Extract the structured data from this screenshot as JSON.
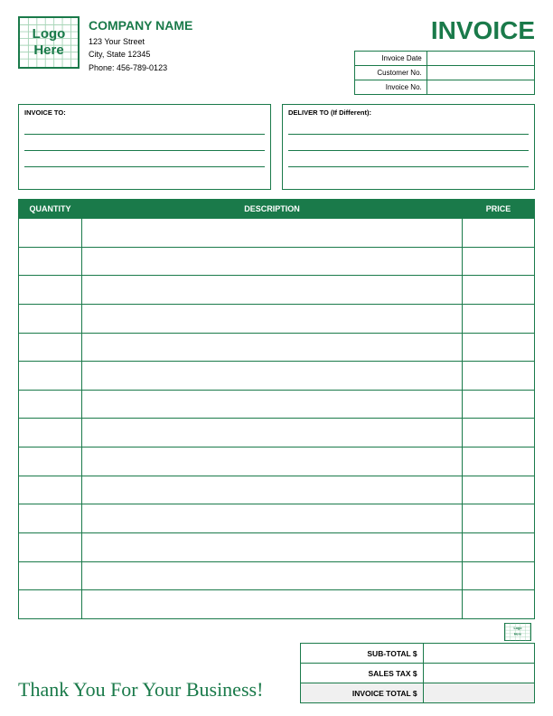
{
  "header": {
    "logo_line1": "Logo",
    "logo_line2": "Here",
    "company_name": "COMPANY NAME",
    "address_line1": "123 Your Street",
    "address_line2": "City, State 12345",
    "phone": "Phone: 456-789-0123",
    "invoice_title": "INVOICE"
  },
  "invoice_fields": {
    "date_label": "Invoice Date",
    "customer_label": "Customer No.",
    "number_label": "Invoice No."
  },
  "address": {
    "invoice_to_label": "INVOICE TO:",
    "deliver_to_label": "DELIVER TO (If Different):"
  },
  "table": {
    "quantity_header": "QUANTITY",
    "description_header": "DESCRIPTION",
    "price_header": "PRICE",
    "rows": [
      {
        "qty": "",
        "desc": "",
        "price": ""
      },
      {
        "qty": "",
        "desc": "",
        "price": ""
      },
      {
        "qty": "",
        "desc": "",
        "price": ""
      },
      {
        "qty": "",
        "desc": "",
        "price": ""
      },
      {
        "qty": "",
        "desc": "",
        "price": ""
      },
      {
        "qty": "",
        "desc": "",
        "price": ""
      },
      {
        "qty": "",
        "desc": "",
        "price": ""
      },
      {
        "qty": "",
        "desc": "",
        "price": ""
      },
      {
        "qty": "",
        "desc": "",
        "price": ""
      },
      {
        "qty": "",
        "desc": "",
        "price": ""
      },
      {
        "qty": "",
        "desc": "",
        "price": ""
      },
      {
        "qty": "",
        "desc": "",
        "price": ""
      },
      {
        "qty": "",
        "desc": "",
        "price": ""
      },
      {
        "qty": "",
        "desc": "",
        "price": ""
      }
    ]
  },
  "totals": {
    "subtotal_label": "SUB-TOTAL $",
    "sales_tax_label": "SALES TAX $",
    "invoice_total_label": "INVOICE TOTAL $"
  },
  "footer": {
    "thank_you": "Thank You For Your Business!"
  }
}
